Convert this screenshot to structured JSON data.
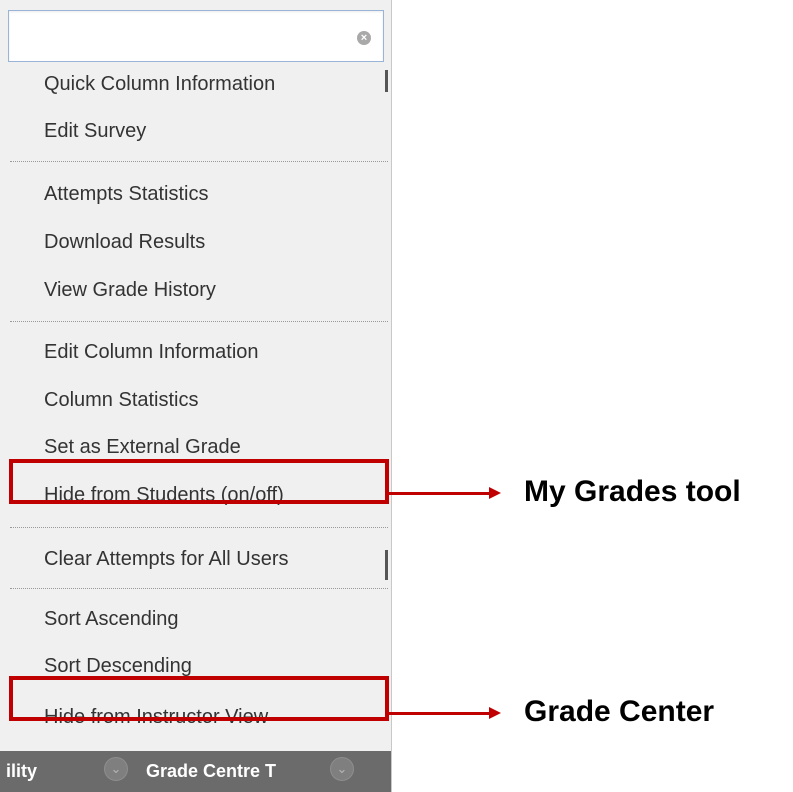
{
  "menu": {
    "search": {
      "value": "",
      "placeholder": ""
    },
    "items": [
      "Quick Column Information",
      "Edit Survey",
      "Attempts Statistics",
      "Download Results",
      "View Grade History",
      "Edit Column Information",
      "Column Statistics",
      "Set as External Grade",
      "Hide from Students (on/off)",
      "Clear Attempts for All Users",
      "Sort Ascending",
      "Sort Descending",
      "Hide from Instructor View"
    ]
  },
  "bottom_bar": {
    "left_text": "ility",
    "right_text": "Grade Centre T"
  },
  "annotations": {
    "callout_1": "My Grades tool",
    "callout_2": "Grade Center",
    "highlight_color": "#c00000"
  }
}
